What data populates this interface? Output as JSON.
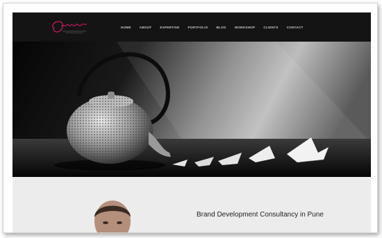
{
  "header": {
    "logo_icon": "script-signature-logo",
    "brand_color": "#c0185c",
    "nav": [
      "HOME",
      "ABOUT",
      "EXPERTISE",
      "PORTFOLIO",
      "BLOG",
      "WORKSHOP",
      "CLIENTS",
      "CONTACT"
    ]
  },
  "hero": {
    "image_description_icon": "teapot-paper-boats-photo"
  },
  "main": {
    "headline": "Brand Development Consultancy in Pune"
  }
}
